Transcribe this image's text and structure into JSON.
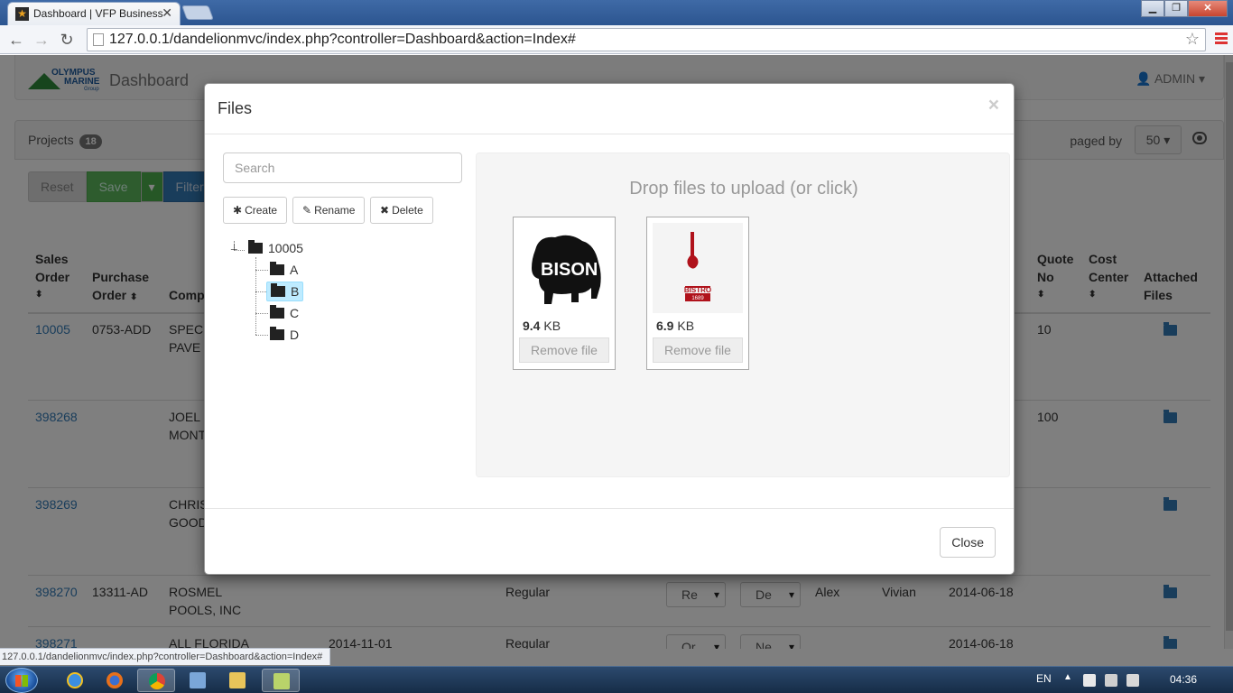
{
  "browser": {
    "tab_title": "Dashboard | VFP Business",
    "tab_close": "✕",
    "url": "127.0.0.1/dandelionmvc/index.php?controller=Dashboard&action=Index#",
    "status_url": "127.0.0.1/dandelionmvc/index.php?controller=Dashboard&action=Index#",
    "back": "←",
    "forward": "→",
    "reload": "↻",
    "star": "☆",
    "win_min": "▁",
    "win_max": "❐",
    "win_close": "✕"
  },
  "app": {
    "logo": {
      "line1": "OLYMPUS",
      "line2": "MARINE",
      "line3": "Group"
    },
    "brand": "Dashboard",
    "user": "ADMIN",
    "user_icon": "👤",
    "user_caret": "▾"
  },
  "panel": {
    "projects_label": "Projects",
    "projects_count": "18",
    "paged_label": "paged by",
    "paged_value": "50 ▾",
    "buttons": {
      "reset": "Reset",
      "save": "Save",
      "save_caret": "▾",
      "filter": "Filter"
    }
  },
  "table": {
    "headers": {
      "sales_order": [
        "Sales",
        "Order"
      ],
      "purchase_order": [
        "Purchase",
        "Order"
      ],
      "company": "Comp",
      "quote_no": [
        "Quote",
        "No"
      ],
      "cost_center": [
        "Cost",
        "Center"
      ],
      "attached_files": [
        "Attached",
        "Files"
      ]
    },
    "sort_glyph": "⬍",
    "rows": [
      {
        "so": "10005",
        "po": "0753-ADD",
        "company": [
          "SPEC",
          "PAVE"
        ],
        "quote": "10"
      },
      {
        "so": "398268",
        "po": "",
        "company": [
          "JOEL",
          "MONT"
        ],
        "quote": "100"
      },
      {
        "so": "398269",
        "po": "",
        "company": [
          "CHRIS",
          "GOOD"
        ],
        "quote": ""
      },
      {
        "so": "398270",
        "po": "13311-AD",
        "company": [
          "ROSMEL",
          "POOLS, INC"
        ],
        "type": "Regular",
        "sel1": "Re",
        "sel2": "De",
        "p1": "Alex",
        "p2": "Vivian",
        "date": "2014-06-18"
      },
      {
        "so": "398271",
        "po": "",
        "company": [
          "ALL FLORIDA",
          ""
        ],
        "extra_date": "2014-11-01",
        "type": "Regular",
        "sel1": "Or",
        "sel2": "Ne",
        "date": "2014-06-18"
      }
    ]
  },
  "modal": {
    "title": "Files",
    "close_x": "×",
    "search_placeholder": "Search",
    "buttons": {
      "create": "Create",
      "create_icon": "✱",
      "rename": "Rename",
      "rename_icon": "✎",
      "delete": "Delete",
      "delete_icon": "✖"
    },
    "tree": {
      "root": "10005",
      "children": [
        "A",
        "B",
        "C",
        "D"
      ],
      "selected": "B",
      "toggle": "⊥"
    },
    "dropzone_message": "Drop files to upload (or click)",
    "files": [
      {
        "size_value": "9.4",
        "size_unit": "KB",
        "remove": "Remove file",
        "image": "bison-logo"
      },
      {
        "size_value": "6.9",
        "size_unit": "KB",
        "remove": "Remove file",
        "image": "bistro-1689-logo",
        "logo_text": [
          "BISTRO",
          "1689"
        ]
      }
    ],
    "close_button": "Close"
  },
  "taskbar": {
    "lang": "EN",
    "tray_arrow": "▲",
    "time": "04:36"
  }
}
